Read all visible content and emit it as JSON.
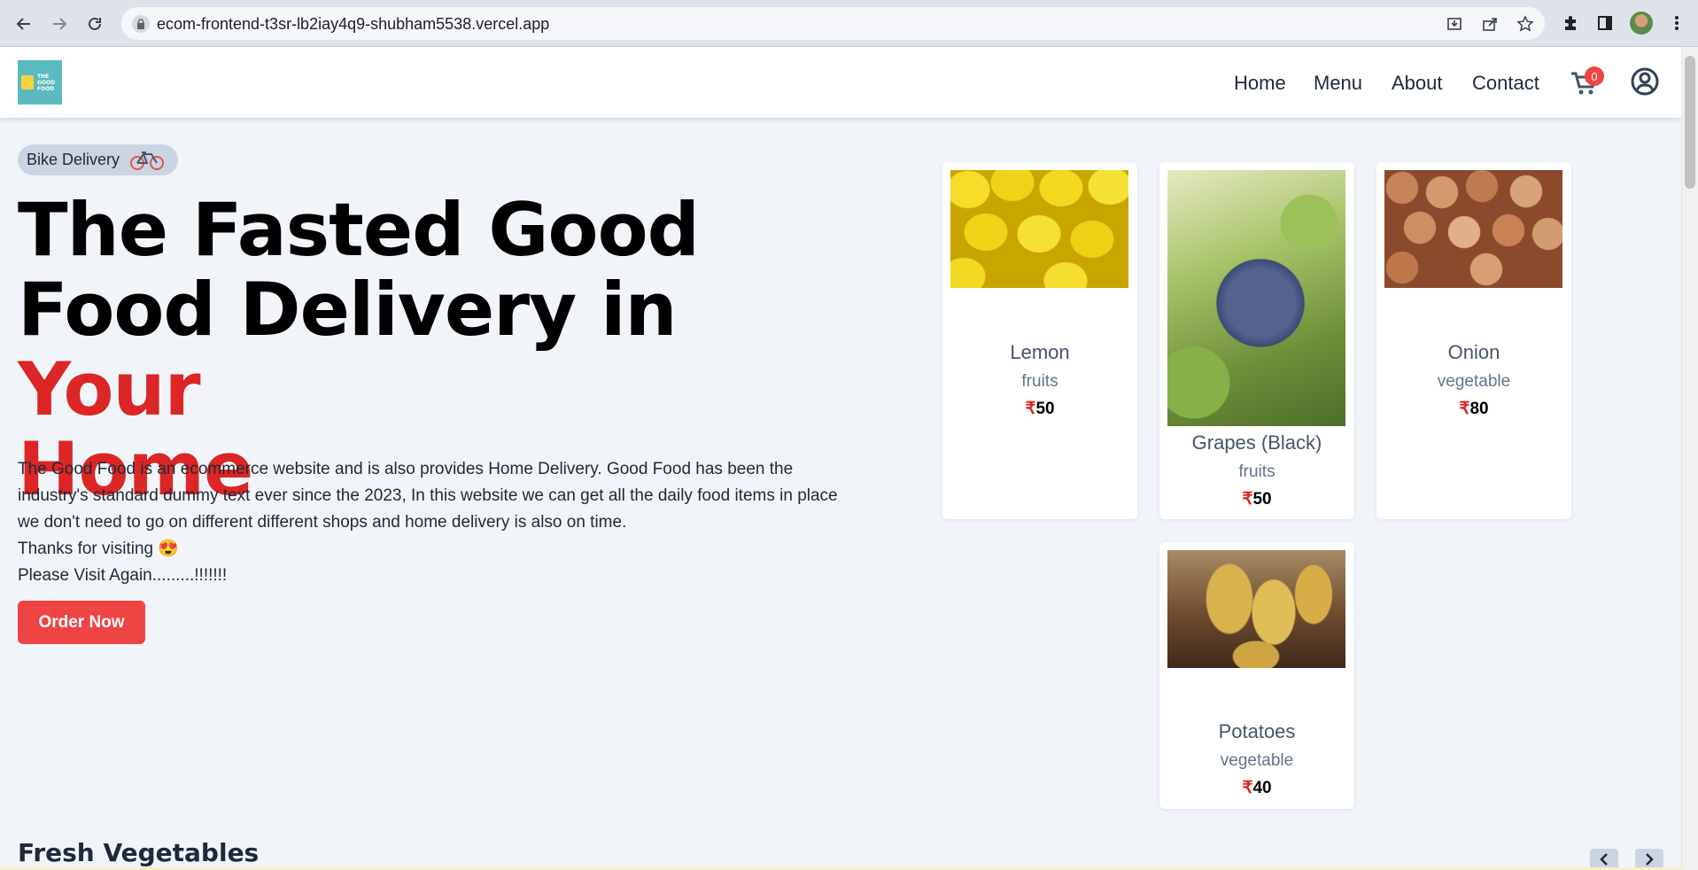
{
  "browser": {
    "url": "ecom-frontend-t3sr-lb2iay4q9-shubham5538.vercel.app"
  },
  "header": {
    "logo_text": "THE GOOD FOOD",
    "nav": [
      "Home",
      "Menu",
      "About",
      "Contact"
    ],
    "cart_count": "0"
  },
  "hero": {
    "pill_label": "Bike Delivery",
    "title_line1": "The Fasted Good",
    "title_line2": "Food Delivery in ",
    "title_red1": "Your",
    "title_red2": "Home",
    "description": "The Good Food is an ecommerce website and is also provides Home Delivery. Good Food has been the industry's standard dummy text ever since the 2023, In this website we can get all the daily food items in place we don't need to go on different different shops and home delivery is also on time.",
    "thanks": "Thanks for visiting 😍",
    "visit_again": "Please Visit Again.........!!!!!!!",
    "order_button": "Order Now"
  },
  "products": [
    {
      "name": "Lemon",
      "category": "fruits",
      "currency": "₹",
      "price": "50"
    },
    {
      "name": "Grapes (Black)",
      "category": "fruits",
      "currency": "₹",
      "price": "50"
    },
    {
      "name": "Onion",
      "category": "vegetable",
      "currency": "₹",
      "price": "80"
    },
    {
      "name": "Potatoes",
      "category": "vegetable",
      "currency": "₹",
      "price": "40"
    }
  ],
  "section": {
    "title": "Fresh Vegetables"
  },
  "colors": {
    "accent_red": "#dc2626",
    "button_red": "#ef4444",
    "page_bg": "#f1f5f9"
  },
  "icons": [
    "back-icon",
    "forward-icon",
    "reload-icon",
    "lock-icon",
    "install-icon",
    "share-icon",
    "star-icon",
    "extensions-icon",
    "sidebar-icon",
    "menu-dots-icon",
    "cart-icon",
    "user-icon",
    "bicycle-icon",
    "chevron-left-icon",
    "chevron-right-icon"
  ]
}
